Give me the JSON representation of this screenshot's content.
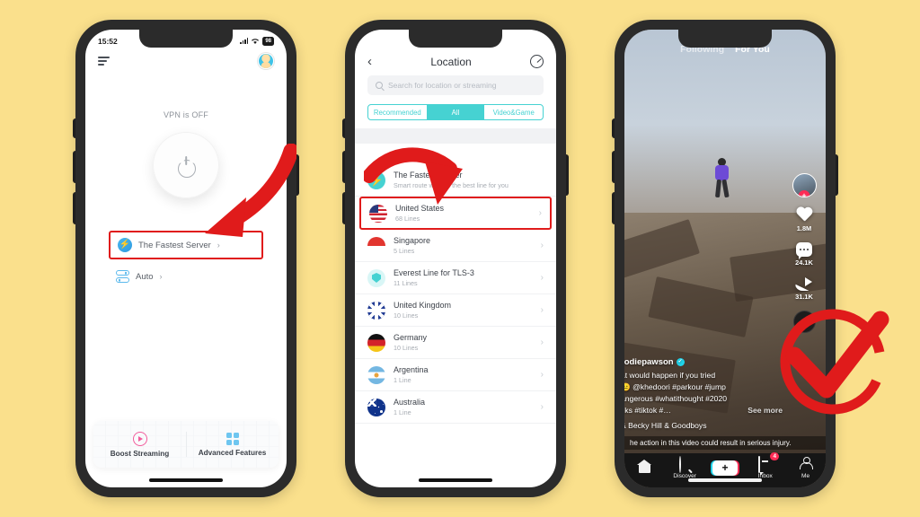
{
  "background_color": "#fae08c",
  "annotation_color": "#e01b1b",
  "phone1": {
    "name": "vpn-home-screen",
    "status_bar": {
      "time": "15:52",
      "battery": "98"
    },
    "header": {
      "menu_icon": "hamburger-menu-icon",
      "avatar": "user-avatar"
    },
    "vpn_state_label": "VPN is OFF",
    "power_button": "power-toggle-button",
    "server_row": {
      "label": "The Fastest Server",
      "chevron": "›",
      "icon": "bolt-icon"
    },
    "auto_row": {
      "label": "Auto",
      "chevron": "›",
      "icon": "auto-servers-icon"
    },
    "bottom_cards": [
      {
        "label": "Boost Streaming",
        "icon": "play-circle-icon"
      },
      {
        "label": "Advanced Features",
        "icon": "grid-squares-icon"
      }
    ]
  },
  "phone2": {
    "name": "location-list-screen",
    "nav": {
      "back_icon": "back-chevron-icon",
      "title": "Location",
      "speed_icon": "speedometer-icon"
    },
    "search": {
      "placeholder": "Search for location or streaming",
      "icon": "search-icon"
    },
    "segments": [
      {
        "label": "Recommended",
        "active": false
      },
      {
        "label": "All",
        "active": true
      },
      {
        "label": "Video&Game",
        "active": false
      }
    ],
    "accent_color": "#46d2d2",
    "section_header": "",
    "items": [
      {
        "name": "The Fastest Server",
        "sub": "Smart route will find the best line for you",
        "icon": "bolt-circle-icon",
        "highlighted": false
      },
      {
        "name": "United States",
        "sub": "68 Lines",
        "icon": "flag-us",
        "highlighted": true
      },
      {
        "name": "Singapore",
        "sub": "5 Lines",
        "icon": "flag-sg",
        "highlighted": false
      },
      {
        "name": "Everest Line for TLS-3",
        "sub": "11 Lines",
        "icon": "shield-icon",
        "highlighted": false
      },
      {
        "name": "United Kingdom",
        "sub": "10 Lines",
        "icon": "flag-uk",
        "highlighted": false
      },
      {
        "name": "Germany",
        "sub": "10 Lines",
        "icon": "flag-de",
        "highlighted": false
      },
      {
        "name": "Argentina",
        "sub": "1 Line",
        "icon": "flag-ar",
        "highlighted": false
      },
      {
        "name": "Australia",
        "sub": "1 Line",
        "icon": "flag-au",
        "highlighted": false
      }
    ]
  },
  "phone3": {
    "name": "tiktok-video-screen",
    "tabs": [
      {
        "label": "Following",
        "active": false
      },
      {
        "label": "For You",
        "active": true
      }
    ],
    "rail": {
      "avatar": "creator-avatar",
      "follow_plus": "+",
      "like_count": "1.8M",
      "comment_count": "24.1K",
      "share_count": "31.1K",
      "disc": "music-disc-icon"
    },
    "caption": {
      "username": "rodiepawson",
      "verified": "✓",
      "line1": "at would happen if you tried",
      "line2": "😐 @khedoori #parkour #jump",
      "line3": "angerous #whatithought #2020",
      "line4": "cks #tiktok #…",
      "see_more": "See more",
      "music": "& Becky Hill & Goodboys"
    },
    "warning": "he action in this video could result in serious injury.",
    "nav": [
      {
        "label": "",
        "icon": "home-icon"
      },
      {
        "label": "Discover",
        "icon": "discover-icon"
      },
      {
        "label": "",
        "icon": "add-post-icon"
      },
      {
        "label": "Inbox",
        "icon": "inbox-icon",
        "badge": "4"
      },
      {
        "label": "Me",
        "icon": "profile-icon"
      }
    ]
  }
}
